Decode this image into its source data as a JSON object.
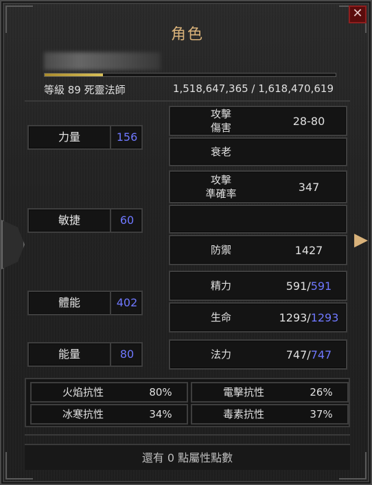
{
  "window": {
    "title": "角色",
    "close_label": "✕"
  },
  "character": {
    "level_class": "等級 89 死靈法師",
    "experience": "1,518,647,365 / 1,618,470,619",
    "xp_progress": 0.2
  },
  "attributes": [
    {
      "label": "力量",
      "value": "156"
    },
    {
      "label": "敏捷",
      "value": "60"
    },
    {
      "label": "體能",
      "value": "402"
    },
    {
      "label": "能量",
      "value": "80"
    }
  ],
  "stats": {
    "attack_damage": {
      "label_line1": "攻擊",
      "label_line2": "傷害",
      "value": "28-80"
    },
    "aging": {
      "label": "衰老",
      "value": ""
    },
    "attack_rating": {
      "label_line1": "攻擊",
      "label_line2": "準確率",
      "value": "347"
    },
    "defense": {
      "label": "防禦",
      "value": "1427"
    },
    "stamina": {
      "label": "精力",
      "current": "591",
      "sep": " / ",
      "max": "591"
    },
    "life": {
      "label": "生命",
      "current": "1293",
      "sep": " / ",
      "max": "1293"
    },
    "mana": {
      "label": "法力",
      "current": "747",
      "sep": " / ",
      "max": "747"
    }
  },
  "resistances": [
    {
      "label": "火焰抗性",
      "value": "80%"
    },
    {
      "label": "電擊抗性",
      "value": "26%"
    },
    {
      "label": "冰寒抗性",
      "value": "34%"
    },
    {
      "label": "毒素抗性",
      "value": "37%"
    }
  ],
  "footer": {
    "remaining_points": "還有 0 點屬性點數"
  },
  "colors": {
    "title": "#d9b27a",
    "accent_blue": "#6f78ff",
    "damage_red": "#ff4c4c"
  },
  "icons": {
    "close": "close-icon",
    "left_ornament": "ornament-icon",
    "right_arrow": "arrow-right-icon"
  }
}
